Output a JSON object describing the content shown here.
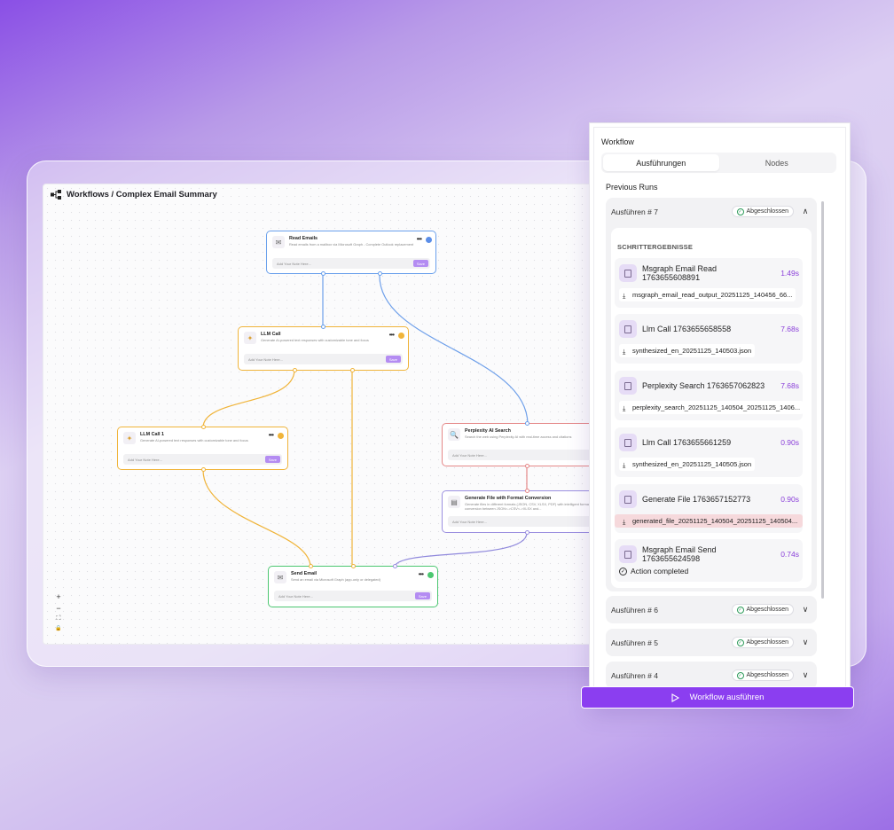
{
  "breadcrumb": "Workflows / Complex Email Summary",
  "nodes": {
    "read_emails": {
      "title": "Read Emails",
      "desc": "Read emails from a mailbox via Microsoft Graph - Complete Outlook replacement",
      "note": "Add Your Note Here...",
      "save": "Save"
    },
    "llm_call": {
      "title": "LLM Call",
      "desc": "Generate AI-powered text responses with customizable tone and focus",
      "note": "Add Your Note Here...",
      "save": "Save"
    },
    "llm_call_1": {
      "title": "LLM Call 1",
      "desc": "Generate AI-powered text responses with customizable tone and focus",
      "note": "Add Your Note Here...",
      "save": "Save"
    },
    "perplexity": {
      "title": "Perplexity AI Search",
      "desc": "Search the web using Perplexity AI with real-time access and citations",
      "note": "Add Your Note Here..."
    },
    "generate_file": {
      "title": "Generate File with Format Conversion",
      "desc": "Generate files in different formats (JSON, CSV, XLSX, PDF) with intelligent format conversion between JSON<->CSV<->XLSX and...",
      "note": "Add Your Note Here..."
    },
    "send_email": {
      "title": "Send Email",
      "desc": "Send an email via Microsoft Graph (app-only or delegated)",
      "note": "Add Your Note Here...",
      "save": "Save"
    }
  },
  "zoom_controls": {
    "plus": "+",
    "minus": "−",
    "fit": "⛶",
    "lock": "🔒"
  },
  "panel": {
    "title": "Workflow",
    "tabs": [
      "Ausführungen",
      "Nodes"
    ],
    "previous_runs": "Previous Runs",
    "results_title": "SCHRITTERGEBNISSE",
    "runs": [
      {
        "label": "Ausführen # 7",
        "status": "Abgeschlossen",
        "chevron": "∧"
      },
      {
        "label": "Ausführen # 6",
        "status": "Abgeschlossen",
        "chevron": "∨"
      },
      {
        "label": "Ausführen # 5",
        "status": "Abgeschlossen",
        "chevron": "∨"
      },
      {
        "label": "Ausführen # 4",
        "status": "Abgeschlossen",
        "chevron": "∨"
      }
    ],
    "steps": [
      {
        "name": "Msgraph Email Read 1763655608891",
        "time": "1.49s",
        "file": "msgraph_email_read_output_20251125_140456_66..."
      },
      {
        "name": "Llm Call 1763655658558",
        "time": "7.68s",
        "file": "synthesized_en_20251125_140503.json"
      },
      {
        "name": "Perplexity Search 1763657062823",
        "time": "7.68s",
        "file": "perplexity_search_20251125_140504_20251125_1406..."
      },
      {
        "name": "Llm Call 1763655661259",
        "time": "0.90s",
        "file": "synthesized_en_20251125_140505.json"
      },
      {
        "name": "Generate File 1763657152773",
        "time": "0.90s",
        "file": "generated_file_20251125_140504_20251125_140504..."
      },
      {
        "name": "Msgraph Email Send 1763655624598",
        "time": "0.74s",
        "file": "Action completed"
      }
    ],
    "run_button": "Workflow ausführen"
  },
  "colors": {
    "accent": "#8b3ef0",
    "blue": "#5b8ee8",
    "orange": "#f0b43a",
    "red": "#e58888",
    "purple": "#9b8fe0",
    "green": "#4cc771"
  }
}
